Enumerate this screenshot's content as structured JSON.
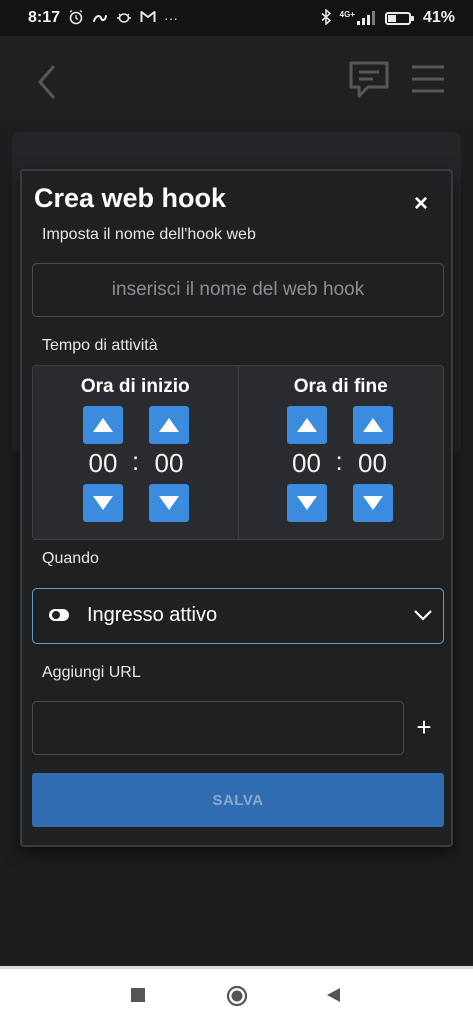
{
  "status_bar": {
    "time": "8:17",
    "notification_icons": [
      "alarm-icon",
      "app-icon",
      "bug-icon",
      "gmail-icon"
    ],
    "more": "···",
    "signal_label": "4G+",
    "battery_percent": "41%",
    "battery_level": 0.41
  },
  "app_bar": {
    "back_icon": "chevron-left-icon",
    "chat_icon": "chat-icon",
    "menu_icon": "hamburger-menu-icon"
  },
  "modal": {
    "title": "Crea web hook",
    "close_label": "×",
    "name_section": {
      "label": "Imposta il nome dell'hook web",
      "value": "",
      "placeholder": "inserisci il nome del web hook"
    },
    "activity": {
      "label": "Tempo di attività",
      "start": {
        "title": "Ora di inizio",
        "hours": "00",
        "minutes": "00",
        "separator": ":"
      },
      "end": {
        "title": "Ora di fine",
        "hours": "00",
        "minutes": "00",
        "separator": ":"
      }
    },
    "when": {
      "label": "Quando",
      "selected": "Ingresso attivo",
      "icon": "toggle-icon"
    },
    "url": {
      "label": "Aggiungi URL",
      "value": "",
      "placeholder": "",
      "add_label": "+"
    },
    "save_label": "SALVA"
  },
  "colors": {
    "accent": "#3b8bde",
    "save_button": "#306cb2",
    "background": "#1c1d1f",
    "modal": "#1f2022"
  },
  "nav_bar": {
    "buttons": [
      "recents-square-icon",
      "home-circle-icon",
      "back-triangle-icon"
    ]
  }
}
